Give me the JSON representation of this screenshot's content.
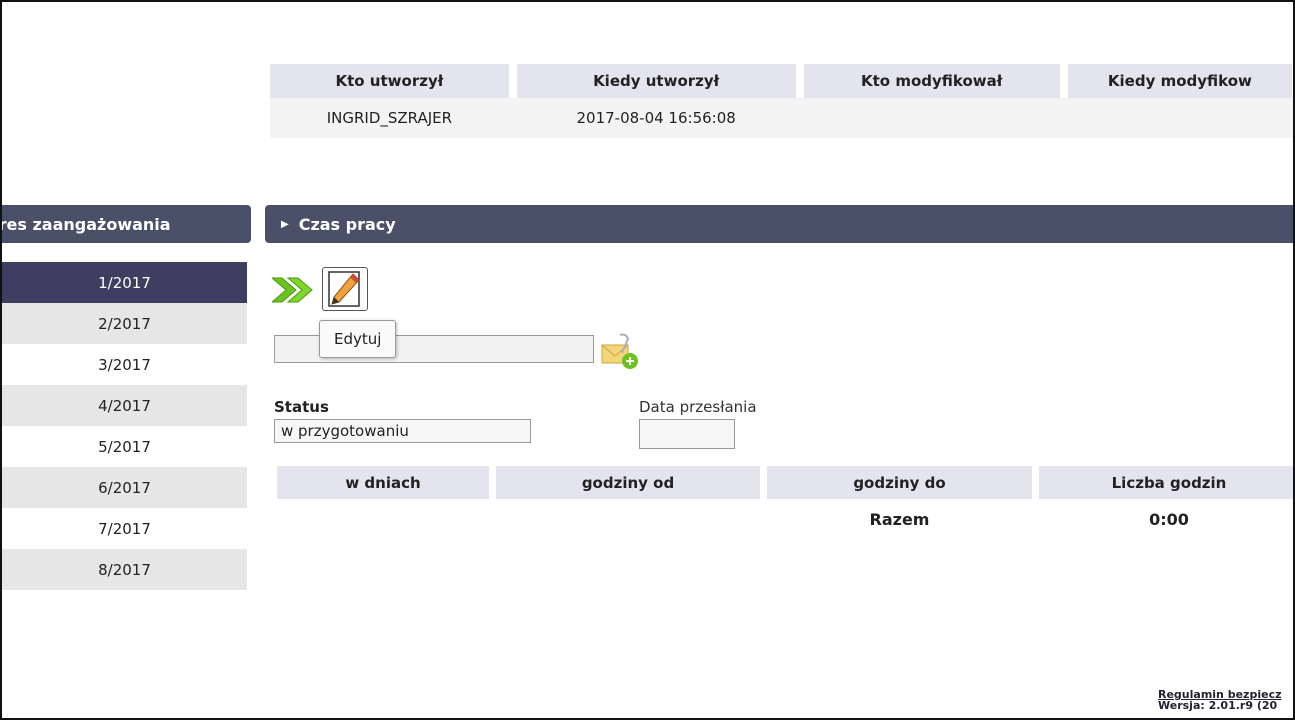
{
  "audit": {
    "headers": [
      "Kto utworzył",
      "Kiedy utworzył",
      "Kto modyfikował",
      "Kiedy modyfikow"
    ],
    "values": [
      "INGRID_SZRAJER",
      "2017-08-04 16:56:08",
      "",
      ""
    ]
  },
  "left_panel": {
    "title": "kres zaangażowania",
    "periods": [
      "1/2017",
      "2/2017",
      "3/2017",
      "4/2017",
      "5/2017",
      "6/2017",
      "7/2017",
      "8/2017"
    ],
    "active_period": "1/2017"
  },
  "section": {
    "title": "Czas pracy",
    "edit_tooltip": "Edytuj",
    "attachment_value": "",
    "status_label": "Status",
    "status_value": "w przygotowaniu",
    "data_label": "Data przesłania",
    "data_value": ""
  },
  "hours_table": {
    "headers": [
      "w dniach",
      "godziny od",
      "godziny do",
      "Liczba godzin"
    ],
    "total_label": "Razem",
    "total_value": "0:00"
  },
  "footer": {
    "regulamin": "Regulamin bezpiecz",
    "version": "Wersja: 2.01.r9 (20"
  },
  "colors": {
    "header_bar": "#4a5068",
    "active_period": "#3c3f60",
    "table_header": "#e4e4ef",
    "arrow_green": "#6cc21f"
  },
  "icons": [
    "double-arrow-icon",
    "pencil-edit-icon",
    "attachment-add-icon",
    "triangle-right-icon"
  ]
}
